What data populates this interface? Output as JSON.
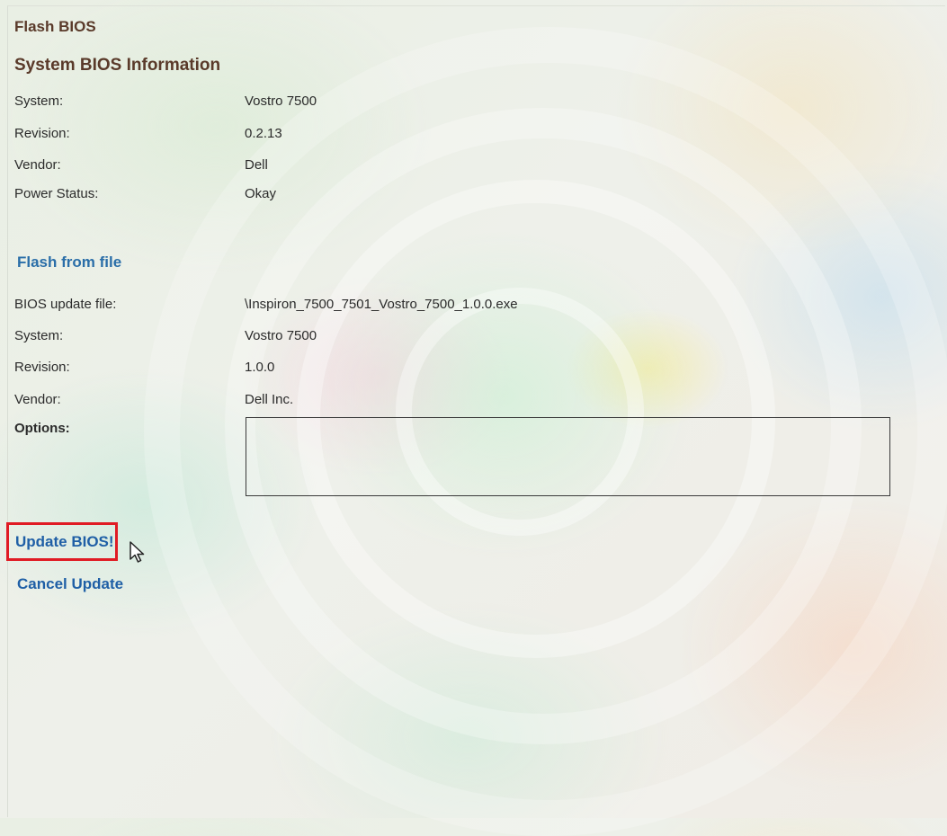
{
  "title": "Flash BIOS",
  "system_info": {
    "heading": "System BIOS Information",
    "rows": [
      {
        "label": "System:",
        "value": "Vostro 7500"
      },
      {
        "label": "Revision:",
        "value": "0.2.13"
      },
      {
        "label": "Vendor:",
        "value": "Dell"
      },
      {
        "label": "Power Status:",
        "value": "Okay"
      }
    ]
  },
  "flash_file": {
    "heading": "Flash from file",
    "rows": [
      {
        "label": "BIOS update file:",
        "value": "\\Inspiron_7500_7501_Vostro_7500_1.0.0.exe"
      },
      {
        "label": "System:",
        "value": "Vostro 7500"
      },
      {
        "label": "Revision:",
        "value": "1.0.0"
      },
      {
        "label": "Vendor:",
        "value": "Dell Inc."
      }
    ],
    "options_label": "Options:"
  },
  "actions": {
    "update_label": "Update BIOS!",
    "cancel_label": "Cancel Update"
  },
  "colors": {
    "heading_brown": "#5a3a2a",
    "link_blue": "#1f5fa6",
    "highlight_red": "#e01b24"
  },
  "icons": {
    "cursor": "mouse-pointer-icon"
  }
}
